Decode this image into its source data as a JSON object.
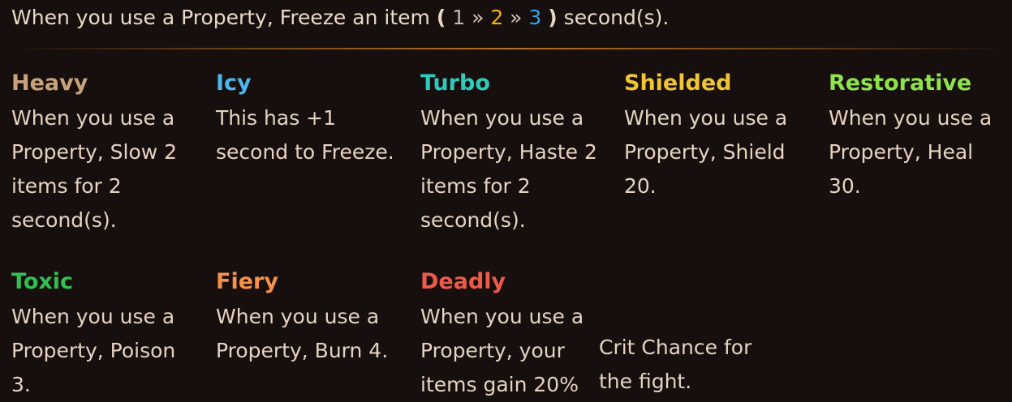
{
  "header": {
    "prefix": "When you use a Property, Freeze an item",
    "open_paren": "(",
    "tiers": [
      {
        "value": "1",
        "color": "#b9b9b9"
      },
      {
        "value": "2",
        "color": "#f0b400"
      },
      {
        "value": "3",
        "color": "#2fa6e8"
      }
    ],
    "separator": "»",
    "close_paren": ")",
    "suffix": "second(s)."
  },
  "enchantments": [
    {
      "name": "Heavy",
      "color": "#c8a27a",
      "description": "When you use a Property, Slow 2 items for 2 second(s)."
    },
    {
      "name": "Icy",
      "color": "#4cb6ef",
      "description": "This has +1 second to Freeze."
    },
    {
      "name": "Turbo",
      "color": "#2ecbbd",
      "description": "When you use a Property, Haste 2 items for 2 second(s)."
    },
    {
      "name": "Shielded",
      "color": "#efc536",
      "description": "When you use a Property, Shield 20."
    },
    {
      "name": "Restorative",
      "color": "#8ee24a",
      "description": "When you use a Property, Heal 30."
    },
    {
      "name": "Toxic",
      "color": "#2fbf53",
      "description": "When you use a Property, Poison 3."
    },
    {
      "name": "Fiery",
      "color": "#f5914a",
      "description": "When you use a Property, Burn 4."
    },
    {
      "name": "Deadly",
      "color": "#ee5a4a",
      "description": "When you use a Property, your items gain 20%"
    }
  ],
  "overflow_text": "Crit Chance for the fight."
}
